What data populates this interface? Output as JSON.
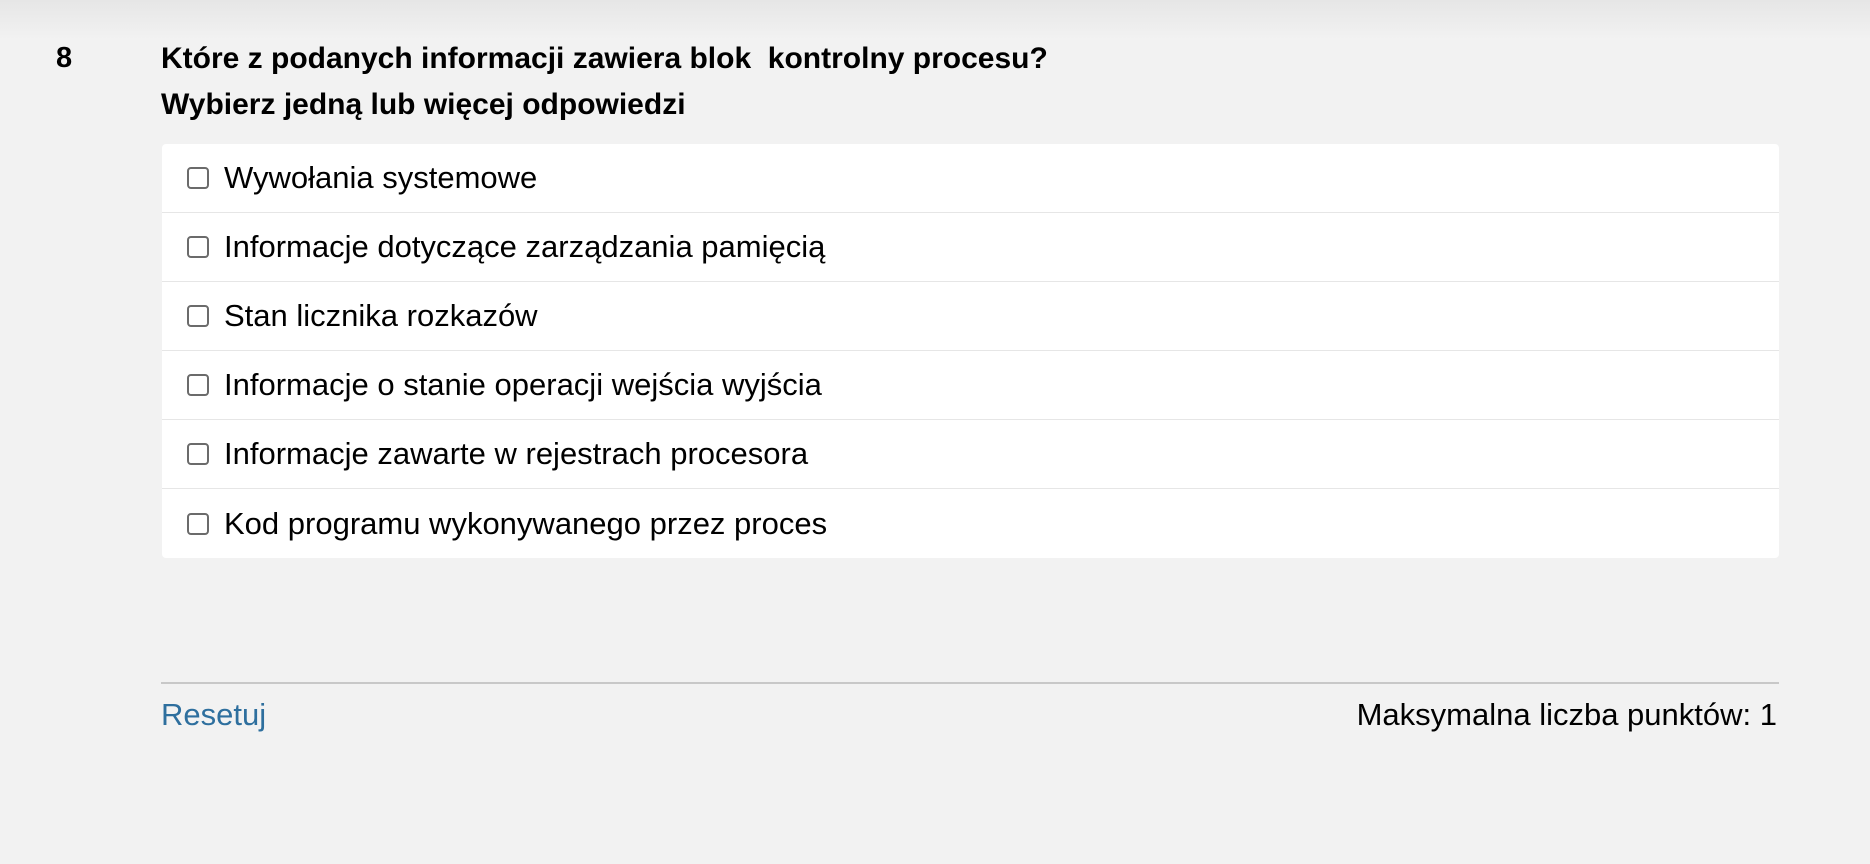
{
  "question": {
    "number": "8",
    "text": "Które z podanych informacji zawiera blok  kontrolny procesu?",
    "instruction": "Wybierz jedną lub więcej odpowiedzi"
  },
  "answers": [
    {
      "label": "Wywołania systemowe",
      "checked": false
    },
    {
      "label": "Informacje dotyczące zarządzania pamięcią",
      "checked": false
    },
    {
      "label": "Stan licznika rozkazów",
      "checked": false
    },
    {
      "label": "Informacje o stanie operacji wejścia wyjścia",
      "checked": false
    },
    {
      "label": "Informacje zawarte w rejestrach procesora",
      "checked": false
    },
    {
      "label": "Kod programu wykonywanego przez proces",
      "checked": false
    }
  ],
  "footer": {
    "reset_label": "Resetuj",
    "max_points_label": "Maksymalna liczba punktów: 1"
  },
  "colors": {
    "background": "#f2f2f2",
    "link": "#2e6f9e"
  }
}
